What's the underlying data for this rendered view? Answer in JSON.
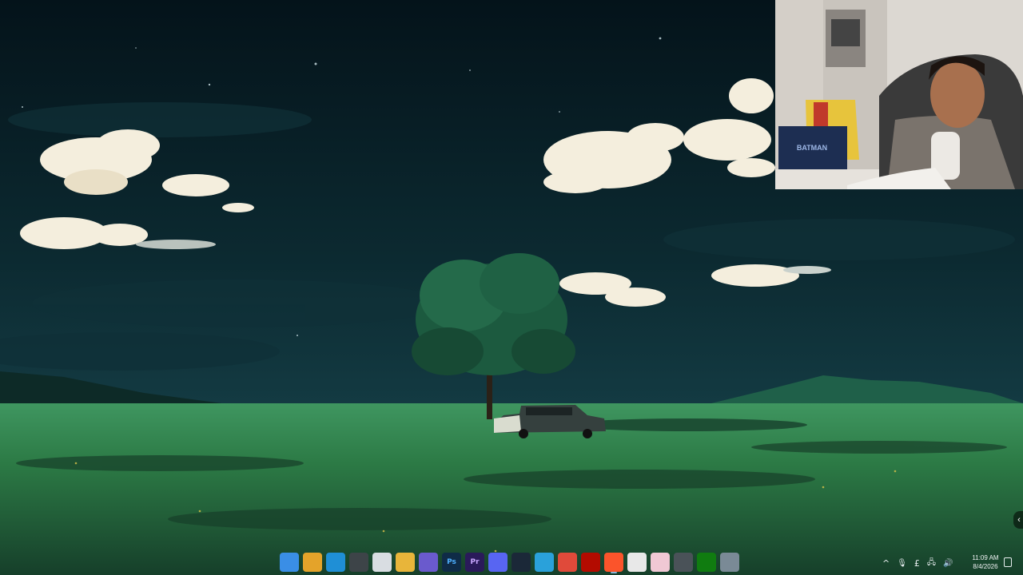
{
  "taskbar": {
    "icons": [
      {
        "name": "start-icon",
        "label": "",
        "color": "#3a8ee6"
      },
      {
        "name": "chrome-icon",
        "label": "",
        "color": "#e4a32a"
      },
      {
        "name": "edge-icon",
        "label": "",
        "color": "#1f8fd6"
      },
      {
        "name": "clock-app-icon",
        "label": "",
        "color": "#3d4448"
      },
      {
        "name": "store-icon",
        "label": "",
        "color": "#d9dde2"
      },
      {
        "name": "file-explorer-icon",
        "label": "",
        "color": "#e8b53a"
      },
      {
        "name": "media-icon",
        "label": "",
        "color": "#6a5acd"
      },
      {
        "name": "photoshop-icon",
        "label": "Ps",
        "color": "#0f2b47"
      },
      {
        "name": "premiere-icon",
        "label": "Pr",
        "color": "#2a1a5a"
      },
      {
        "name": "discord-icon",
        "label": "",
        "color": "#5865f2"
      },
      {
        "name": "steam-icon",
        "label": "",
        "color": "#1b2838"
      },
      {
        "name": "telegram-icon",
        "label": "",
        "color": "#2aa1da"
      },
      {
        "name": "screenrec-icon",
        "label": "",
        "color": "#e04a3a"
      },
      {
        "name": "acrobat-icon",
        "label": "",
        "color": "#b30b00"
      },
      {
        "name": "brave-icon",
        "label": "",
        "color": "#fb542b"
      },
      {
        "name": "notepad-icon",
        "label": "",
        "color": "#e8e8e8"
      },
      {
        "name": "photos-icon",
        "label": "",
        "color": "#f0c8d4"
      },
      {
        "name": "snipping-icon",
        "label": "",
        "color": "#4a5258"
      },
      {
        "name": "xbox-icon",
        "label": "",
        "color": "#107c10"
      },
      {
        "name": "settings-icon",
        "label": "",
        "color": "#7a8a96"
      }
    ],
    "active_icon_index": 14,
    "tray": {
      "chevron": "^",
      "mic": "🎙",
      "lang": "£",
      "network": "🖧",
      "volume": "🔊"
    },
    "time": "11:09 AM",
    "date": "8/4/2026"
  },
  "webcam": {
    "box_text": "BATMAN"
  },
  "colors": {
    "sky_top": "#06161b",
    "sky_bottom": "#123c44",
    "grass": "#2c7a45",
    "tree": "#1e5a3e",
    "cloud": "#f4eedd"
  }
}
